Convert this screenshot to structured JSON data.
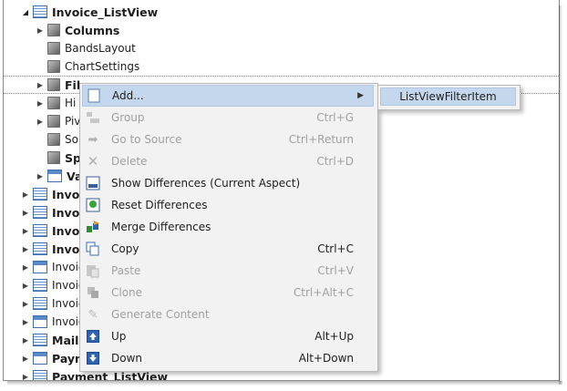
{
  "tree": {
    "root": {
      "label": "Invoice_ListView"
    },
    "children": [
      {
        "label": "Columns",
        "bold": true,
        "expander": true,
        "icon": "cube-icon"
      },
      {
        "label": "BandsLayout",
        "bold": false,
        "expander": false,
        "icon": "cube-icon"
      },
      {
        "label": "ChartSettings",
        "bold": false,
        "expander": false,
        "icon": "cube-icon"
      },
      {
        "label": "Fil",
        "bold": true,
        "expander": true,
        "icon": "cube-icon"
      },
      {
        "label": "Hi",
        "bold": false,
        "expander": true,
        "icon": "cube-icon"
      },
      {
        "label": "Piv",
        "bold": false,
        "expander": true,
        "icon": "cube-icon"
      },
      {
        "label": "So",
        "bold": false,
        "expander": false,
        "icon": "cube-icon"
      },
      {
        "label": "Sp",
        "bold": true,
        "expander": false,
        "icon": "cube-icon"
      },
      {
        "label": "Va",
        "bold": true,
        "expander": true,
        "icon": "view-icon"
      }
    ],
    "siblings": [
      {
        "label": "Invoi",
        "bold": true,
        "icon": "list-view-icon"
      },
      {
        "label": "Invoi",
        "bold": true,
        "icon": "list-view-icon"
      },
      {
        "label": "Invoi",
        "bold": true,
        "icon": "list-view-icon"
      },
      {
        "label": "Invoi",
        "bold": true,
        "icon": "list-view-icon"
      },
      {
        "label": "Invoic",
        "bold": false,
        "icon": "detail-view-icon"
      },
      {
        "label": "Invoic",
        "bold": false,
        "icon": "list-view-icon"
      },
      {
        "label": "Invoic",
        "bold": false,
        "icon": "list-view-icon"
      },
      {
        "label": "Invoic",
        "bold": false,
        "icon": "detail-view-icon"
      },
      {
        "label": "MailS",
        "bold": true,
        "icon": "list-view-icon"
      },
      {
        "label": "Paym",
        "bold": true,
        "icon": "detail-view-icon"
      },
      {
        "label": "Payment_ListView",
        "bold": true,
        "icon": "list-view-icon"
      }
    ]
  },
  "context_menu": {
    "items": [
      {
        "label": "Add...",
        "shortcut": "",
        "enabled": true,
        "highlighted": true,
        "submenu": true,
        "icon": "add-icon"
      },
      {
        "label": "Group",
        "shortcut": "Ctrl+G",
        "enabled": false,
        "icon": "group-icon"
      },
      {
        "label": "Go to Source",
        "shortcut": "Ctrl+Return",
        "enabled": false,
        "icon": "go-to-source-icon"
      },
      {
        "label": "Delete",
        "shortcut": "Ctrl+D",
        "enabled": false,
        "icon": "delete-icon"
      },
      {
        "label": "Show Differences (Current Aspect)",
        "shortcut": "",
        "enabled": true,
        "icon": "show-differences-icon"
      },
      {
        "label": "Reset Differences",
        "shortcut": "",
        "enabled": true,
        "icon": "reset-differences-icon"
      },
      {
        "label": "Merge Differences",
        "shortcut": "",
        "enabled": true,
        "icon": "merge-differences-icon"
      },
      {
        "label": "Copy",
        "shortcut": "Ctrl+C",
        "enabled": true,
        "icon": "copy-icon"
      },
      {
        "label": "Paste",
        "shortcut": "Ctrl+V",
        "enabled": false,
        "icon": "paste-icon"
      },
      {
        "label": "Clone",
        "shortcut": "Ctrl+Alt+C",
        "enabled": false,
        "icon": "clone-icon"
      },
      {
        "label": "Generate Content",
        "shortcut": "",
        "enabled": false,
        "icon": "generate-content-icon"
      },
      {
        "label": "Up",
        "shortcut": "Alt+Up",
        "enabled": true,
        "icon": "up-icon"
      },
      {
        "label": "Down",
        "shortcut": "Alt+Down",
        "enabled": true,
        "icon": "down-icon"
      }
    ]
  },
  "submenu": {
    "items": [
      {
        "label": "ListViewFilterItem"
      }
    ]
  }
}
